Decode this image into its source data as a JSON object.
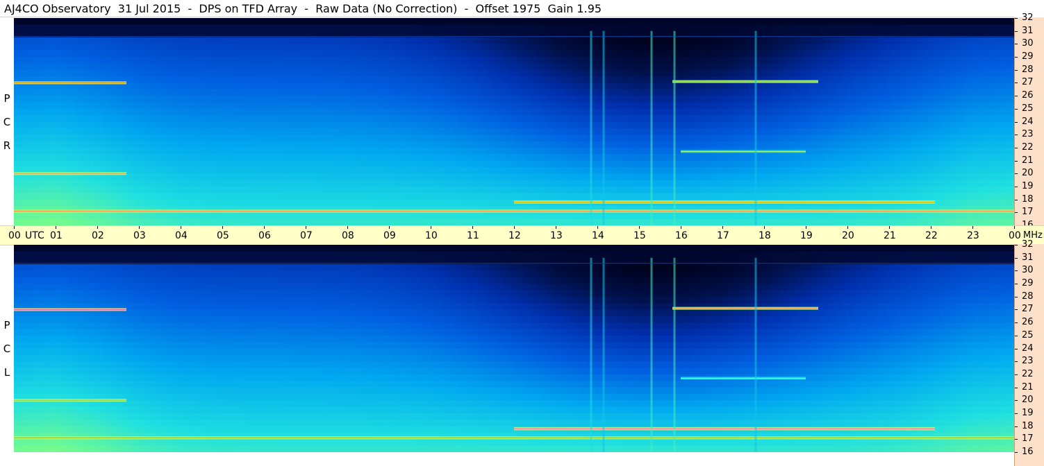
{
  "header": {
    "title": "AJ4CO Observatory  31 Jul 2015  -  DPS on TFD Array  -  Raw Data (No Correction)  -  Offset 1975  Gain 1.95"
  },
  "chart_data": [
    {
      "type": "heatmap",
      "title": "",
      "panel_label": "R C P",
      "x_unit": "UTC",
      "xlim": [
        0,
        24
      ],
      "ylim": [
        16,
        32
      ],
      "y_unit": "MHz",
      "x_ticks": [
        "00",
        "01",
        "02",
        "03",
        "04",
        "05",
        "06",
        "07",
        "08",
        "09",
        "10",
        "11",
        "12",
        "13",
        "14",
        "15",
        "16",
        "17",
        "18",
        "19",
        "20",
        "21",
        "22",
        "23",
        "00"
      ],
      "y_ticks": [
        16,
        17,
        18,
        19,
        20,
        21,
        22,
        23,
        24,
        25,
        26,
        27,
        28,
        29,
        30,
        31,
        32
      ],
      "colormap": [
        "#000018",
        "#00104a",
        "#0030b0",
        "#0060e0",
        "#00a8f0",
        "#20e0e0",
        "#80ff80",
        "#ffff40",
        "#ff6040",
        "#ff40ff"
      ],
      "features": [
        {
          "kind": "band",
          "freq": 17.1,
          "t_start": 0.0,
          "t_end": 24.0,
          "level": 0.72
        },
        {
          "kind": "band",
          "freq": 17.8,
          "t_start": 12.0,
          "t_end": 22.1,
          "level": 0.78
        },
        {
          "kind": "band",
          "freq": 20.0,
          "t_start": 0.0,
          "t_end": 2.7,
          "level": 0.7
        },
        {
          "kind": "band",
          "freq": 27.0,
          "t_start": 0.0,
          "t_end": 2.7,
          "level": 0.8
        },
        {
          "kind": "band",
          "freq": 27.1,
          "t_start": 15.8,
          "t_end": 19.3,
          "level": 0.7
        },
        {
          "kind": "band",
          "freq": 21.7,
          "t_start": 16.0,
          "t_end": 19.0,
          "level": 0.55
        },
        {
          "kind": "vline",
          "t": 13.85,
          "level": 0.55
        },
        {
          "kind": "vline",
          "t": 14.15,
          "level": 0.5
        },
        {
          "kind": "vline",
          "t": 15.3,
          "level": 0.6
        },
        {
          "kind": "vline",
          "t": 15.85,
          "level": 0.6
        },
        {
          "kind": "vline",
          "t": 17.8,
          "level": 0.5
        }
      ]
    },
    {
      "type": "heatmap",
      "title": "",
      "panel_label": "L C P",
      "x_unit": "UTC",
      "xlim": [
        0,
        24
      ],
      "ylim": [
        16,
        32
      ],
      "y_unit": "MHz",
      "x_ticks": [
        "00",
        "01",
        "02",
        "03",
        "04",
        "05",
        "06",
        "07",
        "08",
        "09",
        "10",
        "11",
        "12",
        "13",
        "14",
        "15",
        "16",
        "17",
        "18",
        "19",
        "20",
        "21",
        "22",
        "23",
        "00"
      ],
      "y_ticks": [
        16,
        17,
        18,
        19,
        20,
        21,
        22,
        23,
        24,
        25,
        26,
        27,
        28,
        29,
        30,
        31,
        32
      ],
      "colormap": [
        "#000018",
        "#00104a",
        "#0030b0",
        "#0060e0",
        "#00a8f0",
        "#20e0e0",
        "#80ff80",
        "#ffff40",
        "#ff6040",
        "#ff40ff"
      ],
      "features": [
        {
          "kind": "band",
          "freq": 17.1,
          "t_start": 0.0,
          "t_end": 24.0,
          "level": 0.72
        },
        {
          "kind": "band",
          "freq": 17.8,
          "t_start": 12.0,
          "t_end": 22.1,
          "level": 0.78
        },
        {
          "kind": "band",
          "freq": 20.0,
          "t_start": 0.0,
          "t_end": 2.7,
          "level": 0.7
        },
        {
          "kind": "band",
          "freq": 27.0,
          "t_start": 0.0,
          "t_end": 2.7,
          "level": 0.8
        },
        {
          "kind": "band",
          "freq": 27.1,
          "t_start": 15.8,
          "t_end": 19.3,
          "level": 0.7
        },
        {
          "kind": "band",
          "freq": 21.7,
          "t_start": 16.0,
          "t_end": 19.0,
          "level": 0.55
        },
        {
          "kind": "vline",
          "t": 13.85,
          "level": 0.55
        },
        {
          "kind": "vline",
          "t": 14.15,
          "level": 0.5
        },
        {
          "kind": "vline",
          "t": 15.3,
          "level": 0.6
        },
        {
          "kind": "vline",
          "t": 15.85,
          "level": 0.6
        },
        {
          "kind": "vline",
          "t": 17.8,
          "level": 0.5
        }
      ]
    }
  ],
  "axis": {
    "utc_label": "UTC",
    "mhz_label": "MHz"
  }
}
